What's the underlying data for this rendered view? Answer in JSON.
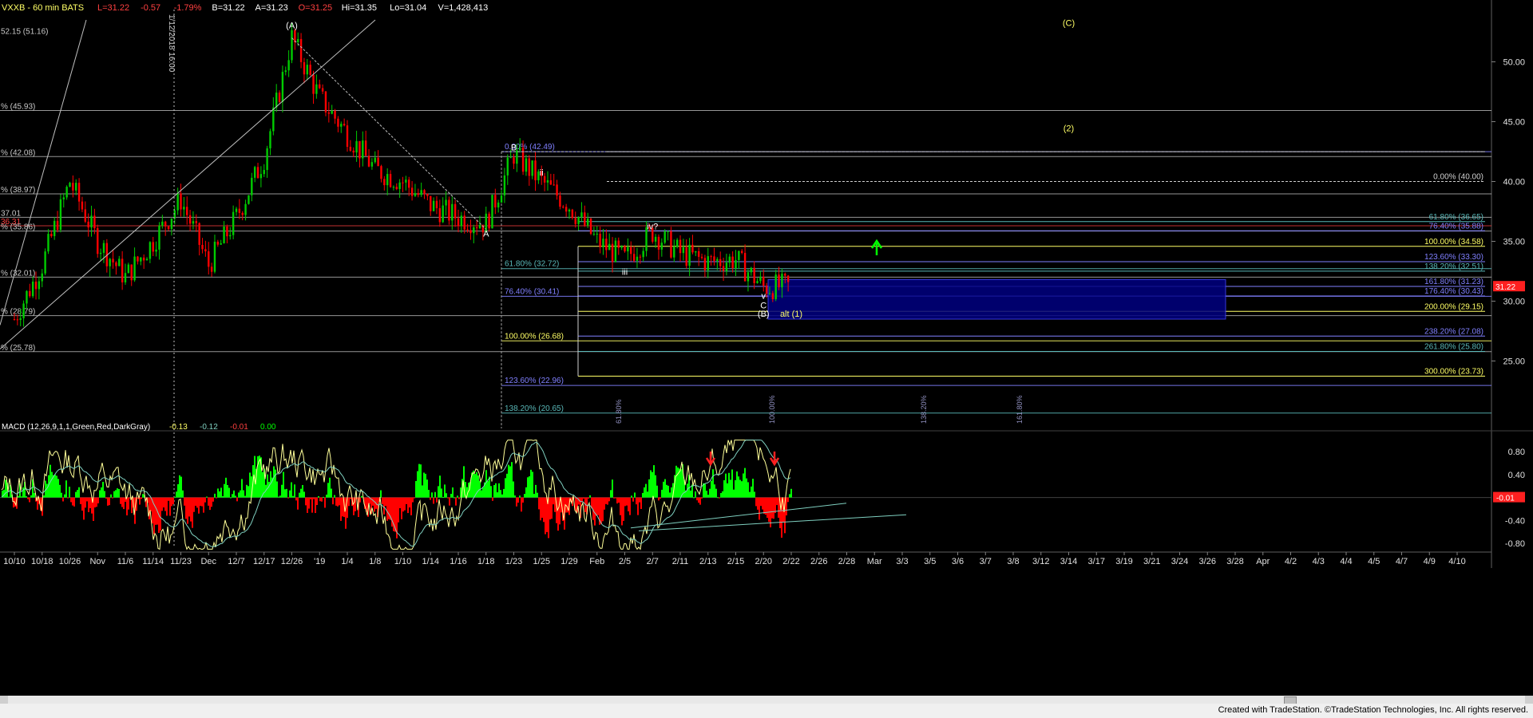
{
  "header": {
    "symbol_text": "VXXB - 60 min  BATS",
    "stats": [
      {
        "text": "L=31.22",
        "color": "#ff4040"
      },
      {
        "text": "-0.57",
        "color": "#ff4040"
      },
      {
        "text": "-1.79%",
        "color": "#ff4040"
      },
      {
        "text": "B=31.22",
        "color": "#ffffff"
      },
      {
        "text": "A=31.23",
        "color": "#ffffff"
      },
      {
        "text": "O=31.25",
        "color": "#ff4040"
      },
      {
        "text": "Hi=31.35",
        "color": "#ffffff"
      },
      {
        "text": "Lo=31.04",
        "color": "#ffffff"
      },
      {
        "text": "V=1,428,413",
        "color": "#ffffff"
      }
    ]
  },
  "colors": {
    "background": "#000000",
    "up_candle": "#00cc00",
    "down_candle": "#ff0000",
    "fib_white": "#c8c8c8",
    "fib_blue": "#8080ff",
    "fib_yellow": "#ffff66",
    "fib_teal": "#59b8b8",
    "box_fill": "#000080",
    "macd_up": "#00ff00",
    "macd_down": "#ff0000",
    "macd_line": "#ffff99",
    "signal_line": "#7fd0c0",
    "arrow_red": "#ff2020",
    "arrow_green": "#00ff00"
  },
  "chart_data": [
    {
      "type": "line",
      "title": "VXXB - 60 min BATS",
      "x": [
        "10/10",
        "10/18",
        "10/26",
        "Nov",
        "11/6",
        "11/14",
        "11/23",
        "Dec",
        "12/7",
        "12/17",
        "12/26",
        "'19",
        "1/4",
        "1/8",
        "1/10",
        "1/14",
        "1/16",
        "1/18",
        "1/23",
        "1/25",
        "1/29",
        "Feb",
        "2/5",
        "2/7",
        "2/11",
        "2/13",
        "2/15",
        "2/20",
        "2/22"
      ],
      "series": [
        {
          "values": [
            28.5,
            33.0,
            40.0,
            35.0,
            32.0,
            35.0,
            38.5,
            33.0,
            37.0,
            42.0,
            52.0,
            47.0,
            44.0,
            41.0,
            40.0,
            38.0,
            37.0,
            36.5,
            42.3,
            40.0,
            38.0,
            35.0,
            33.5,
            35.8,
            34.0,
            33.3,
            33.5,
            31.2,
            31.22
          ]
        }
      ],
      "ylim": [
        19.5,
        53.5
      ],
      "y_ticks": [
        25.0,
        30.0,
        35.0,
        40.0,
        45.0,
        50.0
      ],
      "y_tick_labels": [
        "25.00",
        "30.00",
        "35.00",
        "40.00",
        "45.00",
        "50.00"
      ],
      "x_tick_labels": [
        "10/10",
        "10/18",
        "10/26",
        "Nov",
        "11/6",
        "11/14",
        "11/23",
        "Dec",
        "12/7",
        "12/17",
        "12/26",
        "'19",
        "1/4",
        "1/8",
        "1/10",
        "1/14",
        "1/16",
        "1/18",
        "1/23",
        "1/25",
        "1/29",
        "Feb",
        "2/5",
        "2/7",
        "2/11",
        "2/13",
        "2/15",
        "2/20",
        "2/22",
        "2/26",
        "2/28",
        "Mar",
        "3/3",
        "3/5",
        "3/6",
        "3/7",
        "3/8",
        "3/12",
        "3/14",
        "3/17",
        "3/19",
        "3/21",
        "3/24",
        "3/26",
        "3/28",
        "Apr",
        "4/2",
        "4/3",
        "4/4",
        "4/5",
        "4/7",
        "4/9",
        "4/10"
      ],
      "last_price_label": "31.22",
      "fib_levels_left": [
        {
          "label": "52.15 (51.16)",
          "value": 52.2
        },
        {
          "label": "% (45.93)",
          "value": 45.93
        },
        {
          "label": "% (42.08)",
          "value": 42.08
        },
        {
          "label": "% (38.97)",
          "value": 38.97
        },
        {
          "label": "37.01",
          "value": 37.01
        },
        {
          "label": "36.31",
          "value": 36.3
        },
        {
          "label": "% (35.86)",
          "value": 35.86
        },
        {
          "label": "% (32.01)",
          "value": 32.01
        },
        {
          "label": "% (28.79)",
          "value": 28.79
        },
        {
          "label": "% (25.78)",
          "value": 25.78
        }
      ],
      "fib_levels_mid": [
        {
          "label": "0.00% (42.49)",
          "value": 42.49
        },
        {
          "label": "61.80% (32.72)",
          "value": 32.72
        },
        {
          "label": "76.40% (30.41)",
          "value": 30.41
        },
        {
          "label": "100.00% (26.68)",
          "value": 26.68
        },
        {
          "label": "123.60% (22.96)",
          "value": 22.96
        },
        {
          "label": "138.20% (20.65)",
          "value": 20.65
        }
      ],
      "fib_levels_right": [
        {
          "label": "0.00% (40.00)",
          "value": 40.0
        },
        {
          "label": "61.80% (36.65)",
          "value": 36.65
        },
        {
          "label": "76.40% (35.88)",
          "value": 35.88
        },
        {
          "label": "100.00% (34.58)",
          "value": 34.58
        },
        {
          "label": "123.60% (33.30)",
          "value": 33.3
        },
        {
          "label": "138.20% (32.51)",
          "value": 32.51
        },
        {
          "label": "161.80% (31.23)",
          "value": 31.23
        },
        {
          "label": "176.40% (30.43)",
          "value": 30.43
        },
        {
          "label": "200.00% (29.15)",
          "value": 29.15
        },
        {
          "label": "238.20% (27.08)",
          "value": 27.08
        },
        {
          "label": "261.80% (25.80)",
          "value": 25.8
        },
        {
          "label": "300.00% (23.73)",
          "value": 23.73
        }
      ],
      "wave_labels": [
        {
          "text": "(A)",
          "x": "12/26",
          "y": 52.8
        },
        {
          "text": "(C)",
          "x": "3/14",
          "y": 53.0
        },
        {
          "text": "(2)",
          "x": "3/14",
          "y": 44.2
        },
        {
          "text": "B",
          "x": "1/23",
          "y": 42.6
        },
        {
          "text": "A",
          "x": "1/18",
          "y": 35.4
        },
        {
          "text": "ii",
          "x": "1/25",
          "y": 40.5
        },
        {
          "text": "iii",
          "x": "2/5",
          "y": 32.2
        },
        {
          "text": "iv?",
          "x": "2/7",
          "y": 36.0
        },
        {
          "text": "v",
          "x": "2/20",
          "y": 30.2
        },
        {
          "text": "C",
          "x": "2/20",
          "y": 29.4
        },
        {
          "text": "(B)",
          "x": "2/20",
          "y": 28.7
        },
        {
          "text": "alt (1)",
          "x": "2/22",
          "y": 28.7
        }
      ],
      "date_stamp": "1/12/2018 16:00",
      "time_projections": [
        "61.80%",
        "100.00%",
        "138.20%",
        "161.80%"
      ]
    },
    {
      "type": "bar",
      "title": "MACD (12,26,9,1,1,Green,Red,DarkGray)",
      "readouts": [
        {
          "text": "-0.13",
          "color": "#ffff66"
        },
        {
          "text": "-0.12",
          "color": "#7fd0c0"
        },
        {
          "text": "-0.01",
          "color": "#ff4040"
        },
        {
          "text": "0.00",
          "color": "#00ff00"
        }
      ],
      "ylim": [
        -0.95,
        1.05
      ],
      "y_ticks": [
        0.8,
        0.4,
        -0.4,
        -0.8
      ],
      "y_tick_labels": [
        "0.80",
        "0.40",
        "-0.40",
        "-0.80"
      ],
      "current_value_label": "-0.01"
    }
  ],
  "footer": {
    "credit": "Created with TradeStation. ©TradeStation Technologies, Inc. All rights reserved."
  }
}
